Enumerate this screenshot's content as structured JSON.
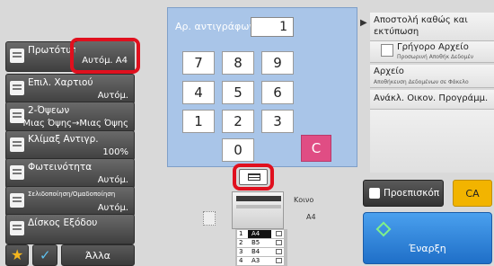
{
  "left_menu": {
    "originals": {
      "label": "Πρωτότυπο",
      "value": "Αυτόμ. A4"
    },
    "paper_select": {
      "label": "Επιλ. Χαρτιού",
      "value": "Αυτόμ."
    },
    "duplex": {
      "label": "2-Όψεων",
      "value": "Μιας Όψης→Μιας Όψης"
    },
    "copy_ratio": {
      "label": "Κλίμαξ Αντιγρ.",
      "value": "100%"
    },
    "exposure": {
      "label": "Φωτεινότητα",
      "value": "Αυτόμ."
    },
    "collate": {
      "label": "Σελιδοποίηση/Ομαδοποίηση",
      "value": "Αυτόμ."
    },
    "output_tray": {
      "label": "Δίσκος Εξόδου"
    },
    "others_label": "Άλλα"
  },
  "copies": {
    "label": "Αρ. αντιγράφων",
    "value": "1",
    "keys": [
      "7",
      "8",
      "9",
      "4",
      "5",
      "6",
      "1",
      "2",
      "3",
      "0"
    ],
    "clear_label": "C"
  },
  "tray_display": {
    "plain_label": "Κοινο",
    "paper_size": "A4",
    "trays": [
      {
        "num": "1",
        "size": "A4"
      },
      {
        "num": "2",
        "size": "B5"
      },
      {
        "num": "3",
        "size": "B4"
      },
      {
        "num": "4",
        "size": "A3"
      }
    ]
  },
  "right_menu": {
    "send_and_print": "Αποστολή καθώς και εκτύπωση",
    "quick_file": {
      "label": "Γρήγορο Αρχείο",
      "sub": "Προσωρινή Αποθήκ Δεδομέν"
    },
    "file": {
      "label": "Αρχείο",
      "sub": "Αποθήκευση Δεδομένων σε Φάκελο"
    },
    "recall_program": "Ανάκλ. Οικον. Προγράμμ."
  },
  "actions": {
    "preview": "Προεπισκόπ",
    "ca": "CA",
    "start": "Έναρξη"
  },
  "colors": {
    "highlight": "#e0101e",
    "clear_key": "#e04d84",
    "ca_button": "#f2b400",
    "start_button": "#2d86e0",
    "panel_bg": "#a9c5e8"
  },
  "icons": {
    "collapse": "chevron-right-icon",
    "favorite": "star-icon",
    "check": "checkmark-icon",
    "start": "diamond-start-icon",
    "preview": "preview-icon"
  }
}
